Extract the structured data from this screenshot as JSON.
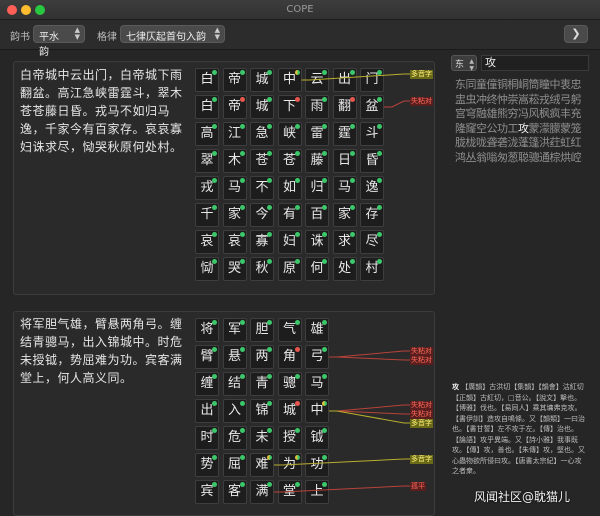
{
  "window": {
    "title": "COPE"
  },
  "toolbar": {
    "rhyme_label": "韵书",
    "rhyme_value": "平水韵",
    "meter_label": "格律",
    "meter_value": "七律仄起首句入韵",
    "nav_icon": "chevron-right-icon"
  },
  "poems": [
    {
      "text": "白帝城中云出门，白帝城下雨翻盆。高江急峡雷霆斗，翠木苍苍藤日昏。戎马不如归马逸，千家今有百家存。哀哀寡妇诛求尽，恸哭秋原何处村。",
      "grid": [
        [
          {
            "c": "白",
            "d": "g"
          },
          {
            "c": "帝",
            "d": "g"
          },
          {
            "c": "城",
            "d": "g"
          },
          {
            "c": "中",
            "d": "y"
          },
          {
            "c": "云",
            "d": "g"
          },
          {
            "c": "出",
            "d": "g"
          },
          {
            "c": "门",
            "d": "g"
          }
        ],
        [
          {
            "c": "白",
            "d": "g"
          },
          {
            "c": "帝",
            "d": "r"
          },
          {
            "c": "城",
            "d": "g"
          },
          {
            "c": "下",
            "d": "r"
          },
          {
            "c": "雨",
            "d": "g"
          },
          {
            "c": "翻",
            "d": "r"
          },
          {
            "c": "盆",
            "d": "g"
          }
        ],
        [
          {
            "c": "高",
            "d": "g"
          },
          {
            "c": "江",
            "d": "g"
          },
          {
            "c": "急",
            "d": "g"
          },
          {
            "c": "峡",
            "d": "g"
          },
          {
            "c": "雷",
            "d": "g"
          },
          {
            "c": "霆",
            "d": "g"
          },
          {
            "c": "斗",
            "d": "g"
          }
        ],
        [
          {
            "c": "翠",
            "d": "g"
          },
          {
            "c": "木",
            "d": "g"
          },
          {
            "c": "苍",
            "d": "g"
          },
          {
            "c": "苍",
            "d": "g"
          },
          {
            "c": "藤",
            "d": "g"
          },
          {
            "c": "日",
            "d": "g"
          },
          {
            "c": "昏",
            "d": "g"
          }
        ],
        [
          {
            "c": "戎",
            "d": "g"
          },
          {
            "c": "马",
            "d": "g"
          },
          {
            "c": "不",
            "d": "g"
          },
          {
            "c": "如",
            "d": "g"
          },
          {
            "c": "归",
            "d": "g"
          },
          {
            "c": "马",
            "d": "g"
          },
          {
            "c": "逸",
            "d": "g"
          }
        ],
        [
          {
            "c": "千",
            "d": "g"
          },
          {
            "c": "家",
            "d": "g"
          },
          {
            "c": "今",
            "d": "g"
          },
          {
            "c": "有",
            "d": "g"
          },
          {
            "c": "百",
            "d": "g"
          },
          {
            "c": "家",
            "d": "g"
          },
          {
            "c": "存",
            "d": "g"
          }
        ],
        [
          {
            "c": "哀",
            "d": "g"
          },
          {
            "c": "哀",
            "d": "g"
          },
          {
            "c": "寡",
            "d": "g"
          },
          {
            "c": "妇",
            "d": "g"
          },
          {
            "c": "诛",
            "d": "g"
          },
          {
            "c": "求",
            "d": "g"
          },
          {
            "c": "尽",
            "d": "g"
          }
        ],
        [
          {
            "c": "恸",
            "d": "g"
          },
          {
            "c": "哭",
            "d": "g"
          },
          {
            "c": "秋",
            "d": "g"
          },
          {
            "c": "原",
            "d": "g"
          },
          {
            "c": "何",
            "d": "g"
          },
          {
            "c": "处",
            "d": "g"
          },
          {
            "c": "村",
            "d": "g"
          }
        ]
      ],
      "tags": [
        {
          "text": "多音字",
          "kind": "ok",
          "row": 0,
          "col": 3
        },
        {
          "text": "失粘对",
          "kind": "bad",
          "row": 1,
          "col": 6
        }
      ]
    },
    {
      "text": "将军胆气雄，臂悬两角弓。缠结青骢马，出入锦城中。时危未授钺，势屈难为功。宾客满堂上，何人高义同。",
      "grid": [
        [
          {
            "c": "将",
            "d": "g"
          },
          {
            "c": "军",
            "d": "g"
          },
          {
            "c": "胆",
            "d": "g"
          },
          {
            "c": "气",
            "d": "g"
          },
          {
            "c": "雄",
            "d": "g"
          }
        ],
        [
          {
            "c": "臂",
            "d": "g"
          },
          {
            "c": "悬",
            "d": "g"
          },
          {
            "c": "两",
            "d": "g"
          },
          {
            "c": "角",
            "d": "r"
          },
          {
            "c": "弓",
            "d": "g"
          }
        ],
        [
          {
            "c": "缠",
            "d": "g"
          },
          {
            "c": "结",
            "d": "g"
          },
          {
            "c": "青",
            "d": "g"
          },
          {
            "c": "骢",
            "d": "g"
          },
          {
            "c": "马",
            "d": "g"
          }
        ],
        [
          {
            "c": "出",
            "d": "g"
          },
          {
            "c": "入",
            "d": "g"
          },
          {
            "c": "锦",
            "d": "g"
          },
          {
            "c": "城",
            "d": "r"
          },
          {
            "c": "中",
            "d": "y"
          }
        ],
        [
          {
            "c": "时",
            "d": "g"
          },
          {
            "c": "危",
            "d": "g"
          },
          {
            "c": "未",
            "d": "g"
          },
          {
            "c": "授",
            "d": "g"
          },
          {
            "c": "钺",
            "d": "g"
          }
        ],
        [
          {
            "c": "势",
            "d": "g"
          },
          {
            "c": "屈",
            "d": "g"
          },
          {
            "c": "难",
            "d": "y"
          },
          {
            "c": "为",
            "d": "y"
          },
          {
            "c": "功",
            "d": "g"
          }
        ],
        [
          {
            "c": "宾",
            "d": "g"
          },
          {
            "c": "客",
            "d": "g"
          },
          {
            "c": "满",
            "d": "g"
          },
          {
            "c": "堂",
            "d": "g"
          },
          {
            "c": "上",
            "d": "g"
          }
        ]
      ],
      "tags": [
        {
          "text": "失粘对",
          "kind": "bad",
          "row": 1,
          "col": 4
        },
        {
          "text": "失粘对",
          "kind": "bad",
          "row": 1,
          "col": 4
        },
        {
          "text": "失粘对",
          "kind": "bad",
          "row": 3,
          "col": 4
        },
        {
          "text": "失粘对",
          "kind": "bad",
          "row": 3,
          "col": 4
        },
        {
          "text": "多音字",
          "kind": "ok",
          "row": 3,
          "col": 4
        },
        {
          "text": "多音字",
          "kind": "ok",
          "row": 5,
          "col": 2
        },
        {
          "text": "孤平",
          "kind": "bad",
          "row": 6,
          "col": 2
        }
      ]
    }
  ],
  "sidebar": {
    "rhyme_select": "东",
    "query": "攻",
    "chars_before": "东同童僮铜桐峒筒瞳中衷忠盅虫冲终忡崇嵩菘戎绒弓躬宫穹融雄熊穷冯风枫疯丰充隆窿空公功工",
    "chars_hl": "攻",
    "chars_after": "蒙濛朦蒙笼胧栊咙聋砻泷蓬篷洪荭虹红鸿丛翁嗡匆葱聪骢通棕烘崆",
    "dict_head": "攻",
    "dict_body": "【廣韻】古洪切【集韻】【韻會】沽紅切【正韻】古紅切，□音公。【說文】擊也。【博雅】伐也。【易同人】乘其墉弗克攻。【書伊訓】造攻自鳴條。又【韻類】一曰治也。【書甘誓】左不攻于左。【傳】治也。【論語】攻乎異端。又【詩小雅】我事既攻。【傳】攻，善也。【朱傳】攻，堅也。又心蟲物欲所侵曰攻。【唐書太宗紀】一心攻之者衆。"
  },
  "watermark": "风闻社区@耽猫儿"
}
